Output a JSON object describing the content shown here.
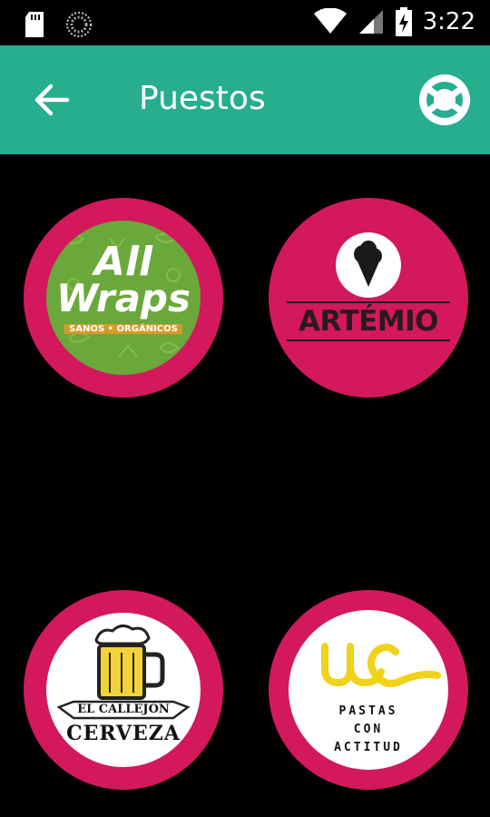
{
  "status_bar": {
    "time": "3:22",
    "icons": [
      "sd-card-icon",
      "loading-icon",
      "wifi-icon",
      "signal-icon",
      "battery-charging-icon"
    ]
  },
  "app_bar": {
    "title": "Puestos",
    "back_icon": "arrow-left-icon",
    "help_icon": "lifebuoy-icon",
    "color": "#26ae8f"
  },
  "stalls": [
    {
      "name": "All Wraps",
      "logo_text_top": "All",
      "logo_text_bottom": "Wraps",
      "tagline": "SANOS • ORGÁNICOS"
    },
    {
      "name": "Artemio",
      "logo_text": "ARTÉMIO",
      "icon": "ice-cream-icon"
    },
    {
      "name": "El Callejón Cerveza",
      "banner_text": "EL CALLEJÓN",
      "logo_text": "CERVEZA",
      "icon": "beer-mug-icon"
    },
    {
      "name": "Pastas con Actitud",
      "logo_mark": "cuc",
      "lines": [
        "PASTAS",
        "CON",
        "ACTITUD"
      ]
    }
  ],
  "colors": {
    "accent": "#26ae8f",
    "stall_ring": "#d3185d",
    "background": "#000000"
  }
}
